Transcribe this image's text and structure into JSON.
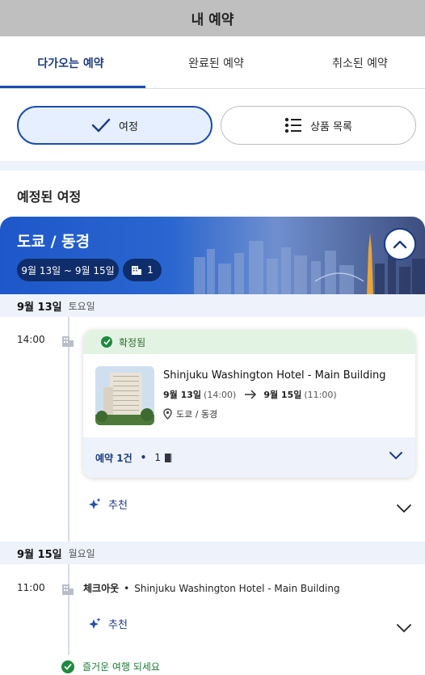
{
  "header": {
    "title": "내 예약"
  },
  "tabs": [
    {
      "label": "다가오는 예약",
      "active": true
    },
    {
      "label": "완료된 예약",
      "active": false
    },
    {
      "label": "취소된 예약",
      "active": false
    }
  ],
  "view_toggle": {
    "itinerary_label": "여정",
    "product_list_label": "상품 목록",
    "selected": "itinerary"
  },
  "section_title": "예정된 여정",
  "trip": {
    "city": "도쿄 / 동경",
    "date_range": "9월 13일 ~ 9월 15일",
    "room_count": "1"
  },
  "days": [
    {
      "date": "9월 13일",
      "weekday": "토요일",
      "time": "14:00",
      "booking": {
        "status": "확정됨",
        "hotel_name": "Shinjuku Washington Hotel - Main Building",
        "checkin_date": "9월 13일",
        "checkin_time": "(14:00)",
        "checkout_date": "9월 15일",
        "checkout_time": "(11:00)",
        "location": "도쿄 / 동경",
        "reservation_count": "예약 1건",
        "room_count": "1"
      },
      "recommend_label": "추천"
    },
    {
      "date": "9월 15일",
      "weekday": "월요일",
      "time": "11:00",
      "checkout_label": "체크아웃",
      "checkout_hotel": "Shinjuku Washington Hotel - Main Building",
      "recommend_label": "추천"
    }
  ],
  "enjoy_message": "즐거운 여행 되세요",
  "colors": {
    "brand": "#1b4db1",
    "brand_dark": "#1b3a86",
    "confirmed_green": "#1e8a3d",
    "confirmed_bg": "#e3f3e3"
  }
}
